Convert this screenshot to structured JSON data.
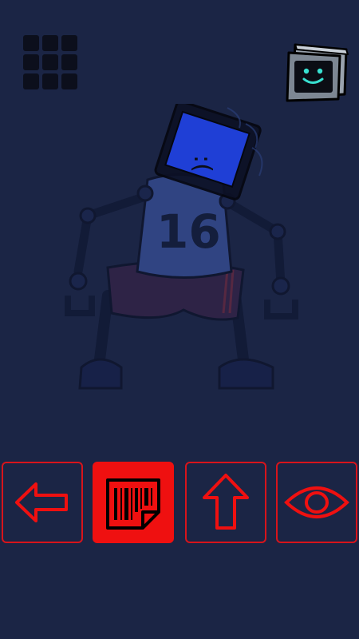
{
  "colors": {
    "background": "#1b2545",
    "accent_red": "#ef1010",
    "screen_blue": "#1f3fd6",
    "monitor_face": "#38e0d0"
  },
  "top_bar": {
    "menu_icon": "grid-menu-icon",
    "avatar_icon": "monitor-smiley-icon"
  },
  "character": {
    "jersey_number": "16",
    "face": ":("
  },
  "controls": [
    {
      "icon": "arrow-left-icon",
      "active": false
    },
    {
      "icon": "barcode-sticker-icon",
      "active": true
    },
    {
      "icon": "arrow-up-icon",
      "active": false
    },
    {
      "icon": "eye-icon",
      "active": false
    }
  ]
}
